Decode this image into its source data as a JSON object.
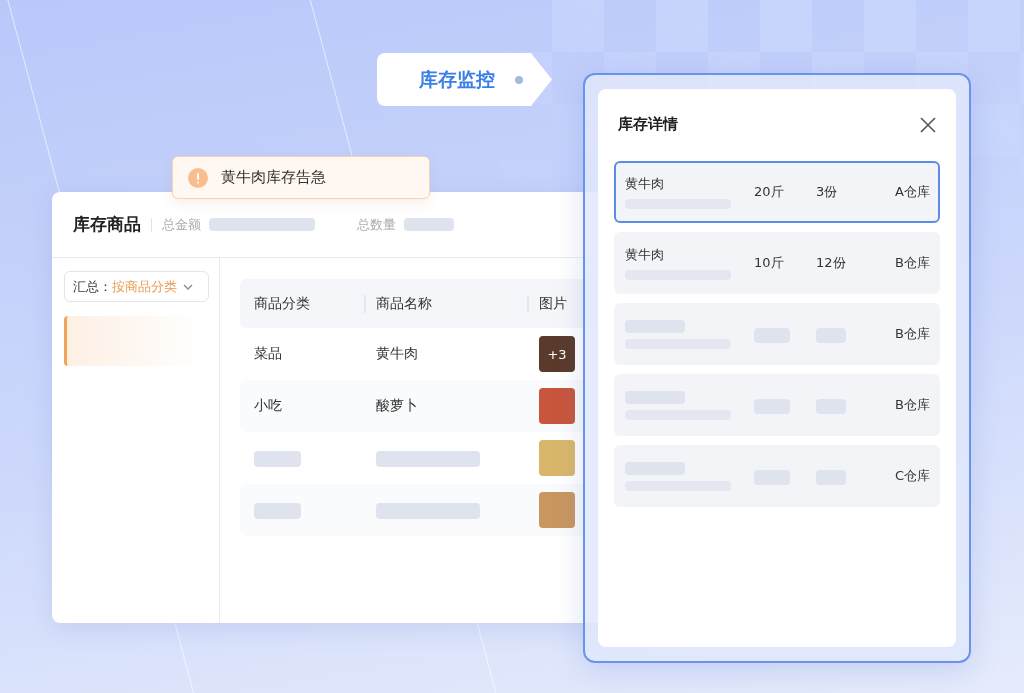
{
  "tag": {
    "label": "库存监控"
  },
  "alert": {
    "message": "黄牛肉库存告急"
  },
  "inventory_card": {
    "title": "库存商品",
    "summary": [
      {
        "label": "总金额"
      },
      {
        "label": "总数量"
      }
    ],
    "dropdown": {
      "label": "汇总：",
      "value": "按商品分类"
    },
    "sidebar": {
      "items": [
        {
          "selected": true
        }
      ]
    },
    "table": {
      "columns": [
        "商品分类",
        "商品名称",
        "图片"
      ],
      "rows": [
        {
          "kind": "text",
          "category": "菜品",
          "name": "黄牛肉",
          "image_badge": "+3"
        },
        {
          "kind": "text",
          "category": "小吃",
          "name": "酸萝卜"
        },
        {
          "kind": "skeleton"
        },
        {
          "kind": "skeleton"
        }
      ]
    }
  },
  "detail_panel": {
    "title": "库存详情",
    "rows": [
      {
        "kind": "text",
        "name": "黄牛肉",
        "weight": "20斤",
        "count": "3份",
        "warehouse": "A仓库",
        "selected": true
      },
      {
        "kind": "text",
        "name": "黄牛肉",
        "weight": "10斤",
        "count": "12份",
        "warehouse": "B仓库",
        "selected": false
      },
      {
        "kind": "skeleton",
        "warehouse": "B仓库",
        "selected": false
      },
      {
        "kind": "skeleton",
        "warehouse": "B仓库",
        "selected": false
      },
      {
        "kind": "skeleton",
        "warehouse": "C仓库",
        "selected": false
      }
    ]
  }
}
